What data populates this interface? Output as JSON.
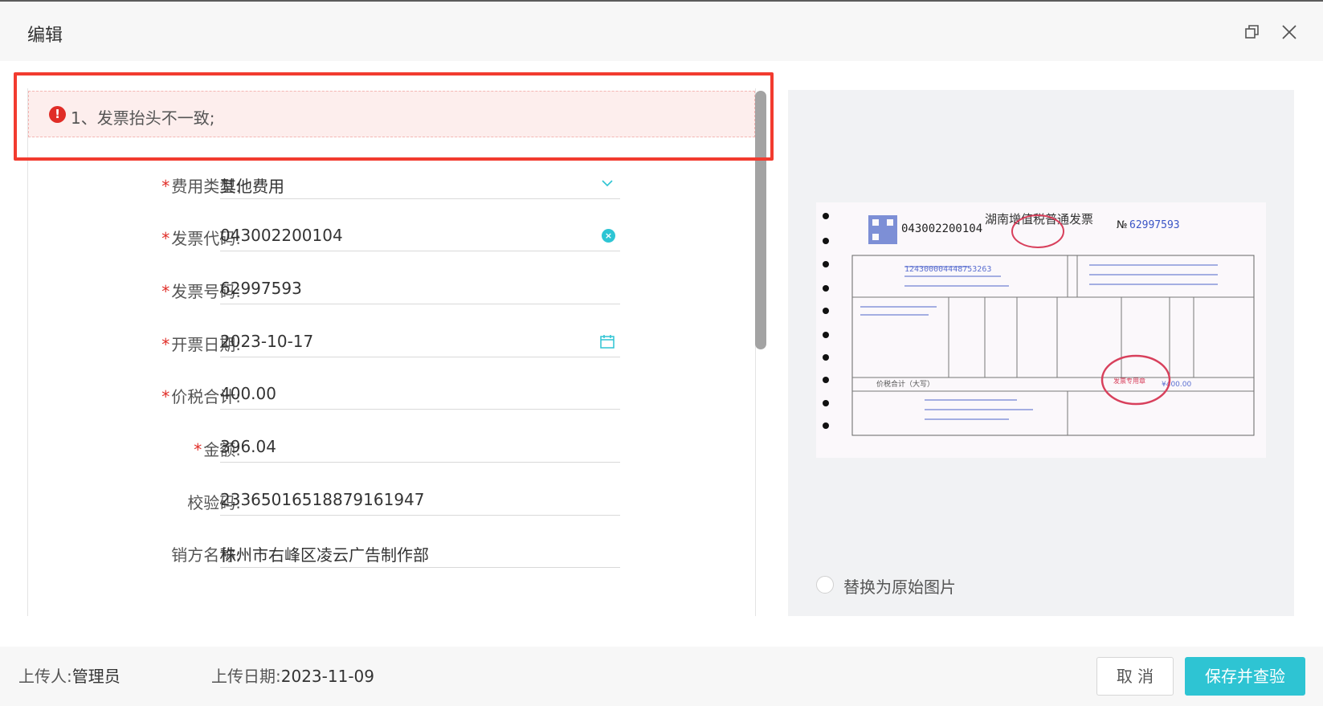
{
  "dialog": {
    "title": "编辑"
  },
  "alert": {
    "icon": "!",
    "message": "1、发票抬头不一致;"
  },
  "form": {
    "fields": [
      {
        "label": "费用类型:",
        "required": true,
        "value": "其他费用",
        "icon": "chevron-down-icon"
      },
      {
        "label": "发票代码:",
        "required": true,
        "value": "043002200104",
        "icon": "clear-icon"
      },
      {
        "label": "发票号码:",
        "required": true,
        "value": "62997593"
      },
      {
        "label": "开票日期:",
        "required": true,
        "value": "2023-10-17",
        "icon": "calendar-icon"
      },
      {
        "label": "价税合计:",
        "required": true,
        "value": "400.00"
      },
      {
        "label": "金额:",
        "required": true,
        "value": "396.04"
      },
      {
        "label": "校验码:",
        "required": false,
        "value": "23365016518879161947"
      },
      {
        "label": "销方名称:",
        "required": false,
        "value": "株州市右峰区凌云广告制作部"
      }
    ],
    "required_mark": "*"
  },
  "preview": {
    "invoice": {
      "title": "湖南增值税普通发票",
      "code": "043002200104",
      "number_prefix": "№",
      "number": "62997593",
      "stamp_label": "发票专用章",
      "buyer_tax_id": "124300004448753263",
      "totals_label": "价税合计（大写）",
      "total_value": "¥400.00"
    },
    "replace_option_label": "替换为原始图片"
  },
  "footer": {
    "uploader_label": "上传人:",
    "uploader": "管理员",
    "upload_date_label": "上传日期:",
    "upload_date": "2023-11-09",
    "cancel_label": "取 消",
    "save_label": "保存并查验"
  },
  "colors": {
    "accent": "#2ec4d3",
    "error": "#e02d27",
    "highlight_border": "#f23b2f",
    "alert_bg": "#fdeeed"
  }
}
